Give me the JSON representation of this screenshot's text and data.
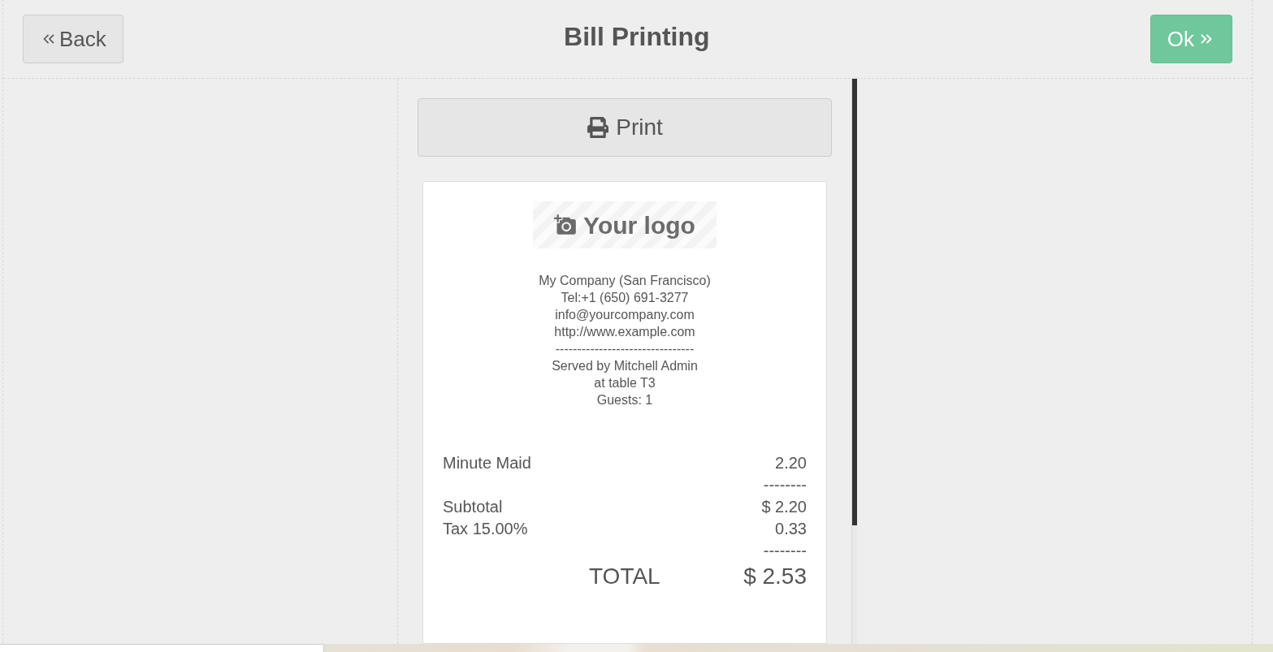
{
  "header": {
    "back_button": {
      "label": "Back"
    },
    "title": "Bill Printing",
    "ok_button": {
      "label": "Ok"
    }
  },
  "print_button": {
    "label": "Print"
  },
  "receipt": {
    "logo_text": "Your logo",
    "header_lines": [
      "My Company (San Francisco)",
      "Tel:+1 (650) 691-3277",
      "info@yourcompany.com",
      "http://www.example.com"
    ],
    "separator": "--------------------------------",
    "service_lines": [
      "Served by Mitchell Admin",
      "at table T3",
      "Guests: 1"
    ],
    "orderlines": [
      {
        "name": "Minute Maid",
        "price": "2.20"
      }
    ],
    "subtotal_separator": "--------",
    "subtotal": {
      "label": "Subtotal",
      "value": "$ 2.20"
    },
    "taxes": [
      {
        "label": "Tax 15.00%",
        "value": "0.33"
      }
    ],
    "total_separator": "--------",
    "total": {
      "label": "TOTAL",
      "value": "$ 2.53"
    }
  }
}
